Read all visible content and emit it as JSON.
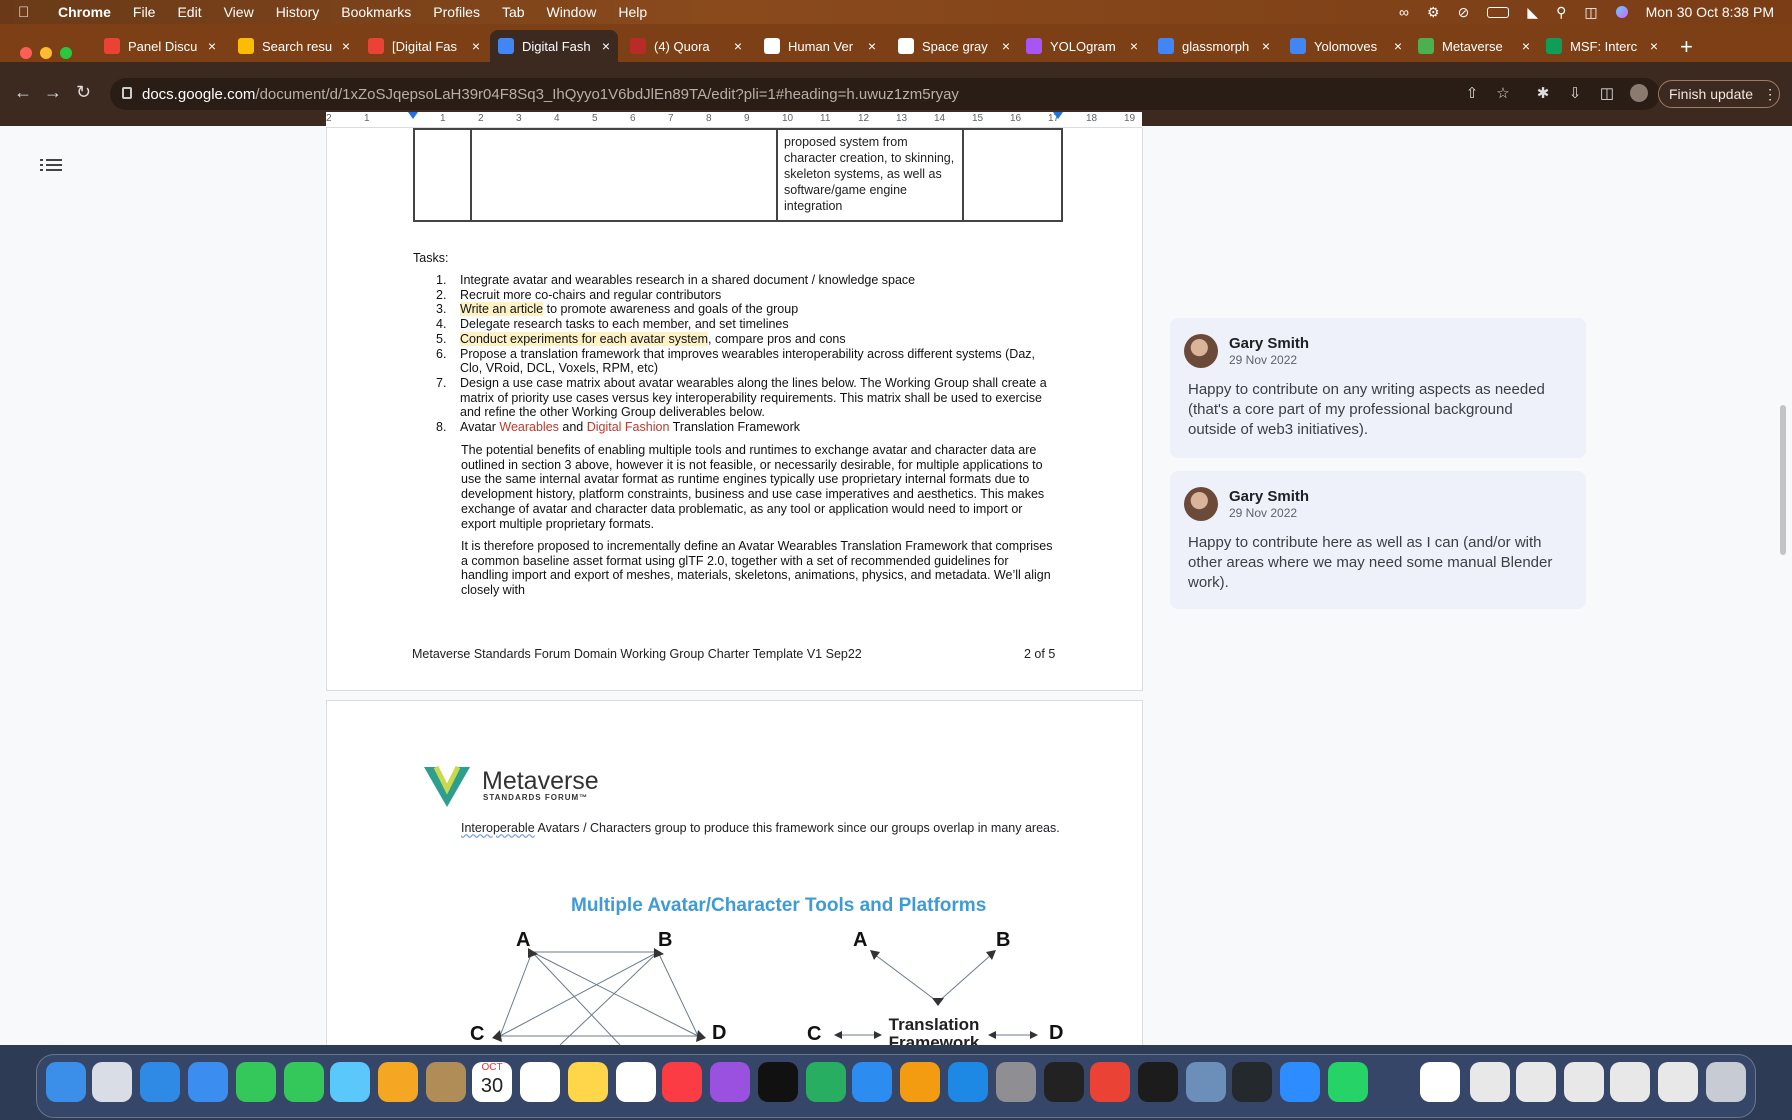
{
  "menubar": {
    "app": "Chrome",
    "items": [
      "File",
      "Edit",
      "View",
      "History",
      "Bookmarks",
      "Profiles",
      "Tab",
      "Window",
      "Help"
    ],
    "clock": "Mon 30 Oct  8:38 PM"
  },
  "tabs": [
    {
      "title": "Panel Discu",
      "icon": "gmail-icon",
      "color": "#ea4335"
    },
    {
      "title": "Search resu",
      "icon": "drive-icon",
      "color": "#fbbc04"
    },
    {
      "title": "[Digital Fas",
      "icon": "gmail-icon",
      "color": "#ea4335"
    },
    {
      "title": "Digital Fash",
      "icon": "docs-icon",
      "color": "#4285f4"
    },
    {
      "title": "(4) Quora",
      "icon": "quora-icon",
      "color": "#b92b27"
    },
    {
      "title": "Human Ver",
      "icon": "notion-icon",
      "color": "#ffffff"
    },
    {
      "title": "Space gray",
      "icon": "apple-icon",
      "color": "#ffffff"
    },
    {
      "title": "YOLOgram",
      "icon": "yolo-icon",
      "color": "#a855f7"
    },
    {
      "title": "glassmorph",
      "icon": "google-icon",
      "color": "#4285f4"
    },
    {
      "title": "Yolomoves",
      "icon": "docs-icon",
      "color": "#4285f4"
    },
    {
      "title": "Metaverse",
      "icon": "msf-icon",
      "color": "#4caf50"
    },
    {
      "title": "MSF: Interc",
      "icon": "sheets-icon",
      "color": "#0f9d58"
    }
  ],
  "active_tab_index": 3,
  "address": {
    "host": "docs.google.com",
    "path": "/document/d/1xZoSJqepsoLaH39r04F8Sq3_IhQyyo1V6bdJlEn89TA/edit?pli=1#heading=h.uwuz1zm5ryay"
  },
  "toolbar": {
    "finish_update": "Finish update"
  },
  "ruler": {
    "ticks": [
      "2",
      "1",
      "1",
      "2",
      "3",
      "4",
      "5",
      "6",
      "7",
      "8",
      "9",
      "10",
      "11",
      "12",
      "13",
      "14",
      "15",
      "16",
      "17",
      "18",
      "19"
    ]
  },
  "table": {
    "cell_text": "proposed system from character creation, to skinning, skeleton systems, as well as software/game engine integration"
  },
  "doc": {
    "tasks_title": "Tasks:",
    "tasks": [
      {
        "n": "1.",
        "parts": [
          {
            "t": "Integrate avatar and wearables research in a shared document / knowledge space",
            "s": ""
          }
        ]
      },
      {
        "n": "2.",
        "parts": [
          {
            "t": "Recruit more co-chairs and regular contributors",
            "s": ""
          }
        ]
      },
      {
        "n": "3.",
        "parts": [
          {
            "t": "Write an article",
            "s": "hl"
          },
          {
            "t": " to promote awareness and goals of the group",
            "s": ""
          }
        ]
      },
      {
        "n": "4.",
        "parts": [
          {
            "t": "Delegate research tasks to each member, and set timelines",
            "s": ""
          }
        ]
      },
      {
        "n": "5.",
        "parts": [
          {
            "t": "Conduct experiments for each avatar system",
            "s": "hl"
          },
          {
            "t": ", compare pros and cons",
            "s": ""
          }
        ]
      },
      {
        "n": "6.",
        "parts": [
          {
            "t": "Propose a translation framework that improves wearables interoperability across different systems (Daz, Clo, VRoid, DCL, Voxels, RPM, etc)",
            "s": ""
          }
        ]
      },
      {
        "n": "7.",
        "parts": [
          {
            "t": "Design a use case matrix about avatar wearables along the lines below. The Working Group shall create a matrix of priority use cases versus key interoperability requirements. This matrix shall be used to exercise and refine the other Working Group deliverables below.",
            "s": ""
          }
        ]
      },
      {
        "n": "8.",
        "parts": [
          {
            "t": "Avatar ",
            "s": ""
          },
          {
            "t": "Wearables",
            "s": "red"
          },
          {
            "t": " and ",
            "s": ""
          },
          {
            "t": "Digital Fashion",
            "s": "red"
          },
          {
            "t": " Translation Framework",
            "s": ""
          }
        ]
      }
    ],
    "para1": "The potential benefits of enabling multiple tools and runtimes to exchange avatar and character data are outlined in section 3 above, however it is not feasible, or necessarily desirable, for multiple applications to use the same internal avatar format as runtime engines typically use proprietary internal formats due to development history, platform constraints, business and use case imperatives and aesthetics. This makes exchange of avatar and character data problematic, as any tool or application would need to import or export multiple proprietary formats.",
    "para2": "It is therefore proposed to incrementally define an Avatar Wearables Translation Framework that comprises a common baseline asset format using glTF 2.0, together with a set of recommended guidelines for handling import and export of meshes, materials, skeletons, animations, physics, and metadata. We’ll align closely with",
    "footer_left": "Metaverse Standards Forum Domain Working Group Charter Template V1 Sep22",
    "footer_right": "2 of 5",
    "logo_name": "Metaverse",
    "logo_sub": "STANDARDS FORUM™",
    "p2_underlined": "Interoperable",
    "p2_rest": " Avatars / Characters group to produce this framework since our groups overlap in many areas.",
    "diagram_title": "Multiple Avatar/Character Tools and Platforms",
    "nodes": {
      "a": "A",
      "b": "B",
      "c": "C",
      "d": "D"
    },
    "translation": "Translation Framework"
  },
  "comments": [
    {
      "name": "Gary Smith",
      "date": "29 Nov 2022",
      "body": "Happy to contribute on any writing aspects as needed (that's a core part of my professional background outside of web3 initiatives)."
    },
    {
      "name": "Gary Smith",
      "date": "29 Nov 2022",
      "body": "Happy to contribute here as well as I can (and/or with other areas where we may need some manual Blender work)."
    }
  ],
  "dock": {
    "calendar_month": "OCT",
    "calendar_day": "30"
  }
}
